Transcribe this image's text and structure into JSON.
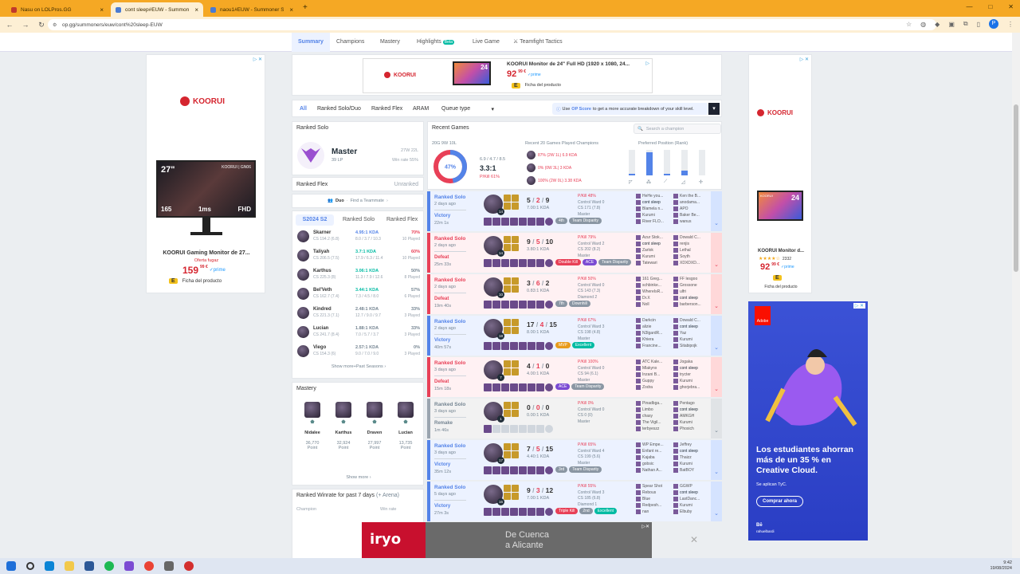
{
  "browser": {
    "tabs": [
      {
        "title": "Nasu on LOLPros.GG"
      },
      {
        "title": "cont sleep#EUW - Summoner S"
      },
      {
        "title": "naou1#EUW - Summoner Stats"
      }
    ],
    "url": "op.gg/summoners/euw/cont%20sleep-EUW"
  },
  "subnav": {
    "items": [
      "Summary",
      "Champions",
      "Mastery",
      "Highlights",
      "Live Game",
      "Teamfight Tactics"
    ],
    "beta": "Beta"
  },
  "ad_top": {
    "title": "KOORUI Monitor de 24\" Full HD (1920 x 1080, 24...",
    "price": "92",
    "cents": "99 €",
    "prime": "✓prime",
    "energy": "E",
    "link": "Ficha del producto",
    "brand": "KOORUI",
    "screen_label": "24"
  },
  "ad_left": {
    "brand": "KOORUI",
    "title": "KOORUI Gaming Monitor de 27...",
    "offer": "Oferta fugaz",
    "price": "159",
    "cents": "99 €",
    "prime": "✓prime",
    "energy": "E",
    "link": "Ficha del producto",
    "screen_size": "27\"",
    "screen_brand": "KOORUI | GN06",
    "screen_fps": "165",
    "screen_ms": "1ms",
    "screen_hd": "FHD"
  },
  "ad_right": {
    "brand": "KOORUI",
    "title": "KOORUI Monitor d...",
    "rating_count": "2332",
    "price": "92",
    "cents": "99 €",
    "prime": "✓prime",
    "energy": "E",
    "link": "Ficha del producto",
    "screen_brand": "KOORUI",
    "screen_label": "24"
  },
  "ad_adobe": {
    "headline": "Los estudiantes ahorran más de un 35 % en Creative Cloud.",
    "terms": "Se aplican TyC.",
    "cta": "Comprar ahora",
    "brand_line1": "Bē",
    "brand_line2": "rahuelbardi",
    "logo": "Adobe"
  },
  "ad_bottom": {
    "brand": "iryo",
    "text1": "De Cuenca",
    "text2": "a Alicante"
  },
  "queue_tabs": {
    "items": [
      "All",
      "Ranked Solo/Duo",
      "Ranked Flex",
      "ARAM"
    ],
    "queue_type": "Queue type",
    "op_score_pre": "Use",
    "op_score_link": "OP Score",
    "op_score_post": "to get a more accurate breakdown of your skill level."
  },
  "ranked_solo": {
    "title": "Ranked Solo",
    "tier": "Master",
    "lp": "39 LP",
    "wl": "27W 22L",
    "wr": "Win rate 55%"
  },
  "ranked_flex": {
    "title": "Ranked Flex",
    "status": "Unranked"
  },
  "duo": {
    "label": "Duo",
    "text": "Find a Teammate"
  },
  "season_tabs": [
    "S2024 S2",
    "Ranked Solo",
    "Ranked Flex"
  ],
  "champ_stats": [
    {
      "name": "Skarner",
      "cs": "CS 194.2 (6.8)",
      "kda": "4.95:1 KDA",
      "kdad": "8.0 / 3.7 / 10.3",
      "wr": "70%",
      "played": "10 Played",
      "kc": "#5383e8",
      "wc": "#e84057"
    },
    {
      "name": "Taliyah",
      "cs": "CS 206.5 (7.5)",
      "kda": "3.7:1 KDA",
      "kdad": "17.9 / 6.3 / 11.4",
      "wr": "60%",
      "played": "10 Played",
      "kc": "#00bba3",
      "wc": "#e84057"
    },
    {
      "name": "Karthus",
      "cs": "CS 225.3 (8)",
      "kda": "3.06:1 KDA",
      "kdad": "11.3 / 7.9 / 12.6",
      "wr": "50%",
      "played": "8 Played",
      "kc": "#00bba3",
      "wc": "#758592"
    },
    {
      "name": "Bel'Veth",
      "cs": "CS 162.7 (7.4)",
      "kda": "3.44:1 KDA",
      "kdad": "7.3 / 4.5 / 8.0",
      "wr": "57%",
      "played": "6 Played",
      "kc": "#00bba3",
      "wc": "#758592"
    },
    {
      "name": "Kindred",
      "cs": "CS 221.3 (7.1)",
      "kda": "2.48:1 KDA",
      "kdad": "12.7 / 9.0 / 9.7",
      "wr": "33%",
      "played": "3 Played",
      "kc": "#758592",
      "wc": "#758592"
    },
    {
      "name": "Lucian",
      "cs": "CS 241.7 (8.4)",
      "kda": "1.88:1 KDA",
      "kdad": "7.0 / 5.7 / 3.7",
      "wr": "33%",
      "played": "3 Played",
      "kc": "#758592",
      "wc": "#758592"
    },
    {
      "name": "Viego",
      "cs": "CS 154.3 (6)",
      "kda": "2.57:1 KDA",
      "kdad": "9.0 / 7.0 / 9.0",
      "wr": "0%",
      "played": "3 Played",
      "kc": "#758592",
      "wc": "#758592"
    }
  ],
  "show_more_seasons": "Show more+Past Seasons",
  "mastery": {
    "title": "Mastery",
    "champs": [
      {
        "name": "Nidalee",
        "points": "36,770",
        "label": "Point"
      },
      {
        "name": "Karthus",
        "points": "32,924",
        "label": "Point"
      },
      {
        "name": "Draven",
        "points": "27,997",
        "label": "Point"
      },
      {
        "name": "Lucian",
        "points": "13,735",
        "label": "Point"
      }
    ],
    "show_more": "Show more"
  },
  "ranked_winrate": {
    "title": "Ranked Winrate for past 7 days",
    "sub": "(+ Arena)",
    "col1": "Champion",
    "col2": "Win rate"
  },
  "recent": {
    "title": "Recent Games",
    "search_placeholder": "Search a champion",
    "record": "20G 9W 10L",
    "pct": "47%",
    "pct_value": 47,
    "kda_line": "6.9 / 4.7 / 8.5",
    "kda": "3.3:1",
    "pkill": "P/Kill 61%",
    "played_title": "Recent 20 Games Played Champions",
    "played": [
      {
        "text": "87% (2W 1L) 6.9 KDA"
      },
      {
        "text": "0% (0W 3L) 3 KDA"
      },
      {
        "text": "100% (2W 0L) 3.38 KDA"
      }
    ],
    "pos_title": "Preferred Position (Rank)",
    "positions": [
      0.05,
      0.9,
      0.05,
      0.2,
      0.0
    ]
  },
  "matches": [
    {
      "type": "Ranked Solo",
      "ago": "2 days ago",
      "res": "Victory",
      "dur": "22m 1s",
      "cls": "win",
      "lvl": "14",
      "k": "5",
      "d": "2",
      "a": "9",
      "kdar": "7.00:1 KDA",
      "badges": [
        {
          "t": "4th",
          "c": ""
        },
        {
          "t": "Team Disparity",
          "c": ""
        }
      ],
      "stats": [
        "P/Kill 48%",
        "Control Ward 0",
        "CS 171 (7.8)",
        "Master"
      ],
      "team1": [
        "HeHe you...",
        "cont sleep",
        "Blamela n...",
        "Kurumi",
        "River FLO..."
      ],
      "team2": [
        "Ken the B...",
        "anodama...",
        "APO",
        "Baker Be...",
        "wanus"
      ]
    },
    {
      "type": "Ranked Solo",
      "ago": "2 days ago",
      "res": "Defeat",
      "dur": "25m 33s",
      "cls": "loss",
      "lvl": "14",
      "k": "9",
      "d": "5",
      "a": "10",
      "kdar": "3.80:1 KDA",
      "badges": [
        {
          "t": "Double Kill",
          "c": "b-red"
        },
        {
          "t": "ACE",
          "c": "b-purple"
        },
        {
          "t": "Team Disparity",
          "c": ""
        }
      ],
      "stats": [
        "P/Kill 79%",
        "Control Ward 2",
        "CS 202 (8.2)",
        "Master"
      ],
      "team1": [
        "Azur Stok...",
        "cont sleep",
        "Zarlok",
        "Kurumi",
        "Tatewari"
      ],
      "team2": [
        "Dowald C...",
        "renjis",
        "Lethal",
        "Soyth",
        "XDXDXD..."
      ]
    },
    {
      "type": "Ranked Solo",
      "ago": "2 days ago",
      "res": "Defeat",
      "dur": "19m 40s",
      "cls": "loss",
      "lvl": "10",
      "k": "3",
      "d": "6",
      "a": "2",
      "kdar": "0.83:1 KDA",
      "badges": [
        {
          "t": "7th",
          "c": ""
        },
        {
          "t": "Downhill",
          "c": ""
        }
      ],
      "stats": [
        "P/Kill 50%",
        "Control Ward 0",
        "CS 143 (7.3)",
        "Diamond 2"
      ],
      "team1": [
        "161 Greg...",
        "schbinke...",
        "WhereIsR...",
        "Dr.X",
        "Noll"
      ],
      "team2": [
        "FF lesgoo",
        "Grossone",
        "ulfri",
        "cont sleep",
        "barberson..."
      ]
    },
    {
      "type": "Ranked Solo",
      "ago": "2 days ago",
      "res": "Victory",
      "dur": "40m 57s",
      "cls": "win",
      "lvl": "18",
      "k": "17",
      "d": "4",
      "a": "15",
      "kdar": "8.00:1 KDA",
      "badges": [
        {
          "t": "MVP",
          "c": "b-orange"
        },
        {
          "t": "Excellent",
          "c": "b-green"
        }
      ],
      "stats": [
        "P/Kill 67%",
        "Control Ward 3",
        "CS 198 (4.8)",
        "Master"
      ],
      "team1": [
        "Darkcin",
        "alizie",
        "N3lgardR...",
        "Khiera",
        "Francine..."
      ],
      "team2": [
        "Dowald C...",
        "cont sleep",
        "Yaz",
        "Kurumi",
        "Sitabipojk"
      ]
    },
    {
      "type": "Ranked Solo",
      "ago": "3 days ago",
      "res": "Defeat",
      "dur": "15m 18s",
      "cls": "loss",
      "lvl": "7",
      "k": "4",
      "d": "1",
      "a": "0",
      "kdar": "4.00:1 KDA",
      "badges": [
        {
          "t": "ACE",
          "c": "b-purple"
        },
        {
          "t": "Team Disparity",
          "c": ""
        }
      ],
      "stats": [
        "P/Kill 100%",
        "Control Ward 0",
        "CS 94 (6.1)",
        "Master"
      ],
      "team1": [
        "ATC Kale...",
        "Mlakynx",
        "Inzani B...",
        "Guppy",
        "Zodra"
      ],
      "team2": [
        "Jogaka",
        "cont sleep",
        "trycter",
        "Kurumi",
        "ghorjebra..."
      ]
    },
    {
      "type": "Ranked Solo",
      "ago": "3 days ago",
      "res": "Remake",
      "dur": "1m 46s",
      "cls": "remake",
      "lvl": "1",
      "k": "0",
      "d": "0",
      "a": "0",
      "kdar": "0.00:1 KDA",
      "badges": [],
      "stats": [
        "P/Kill 0%",
        "Control Ward 0",
        "CS 0 (0)",
        "Master"
      ],
      "team1": [
        "Pinadbga...",
        "Limbo",
        "chasy",
        "The Vigil...",
        "terbyeszz"
      ],
      "team2": [
        "Pentago",
        "cont sleep",
        "AMKGH",
        "Kurumi",
        "Phoxich"
      ]
    },
    {
      "type": "Ranked Solo",
      "ago": "3 days ago",
      "res": "Victory",
      "dur": "35m 12s",
      "cls": "win",
      "lvl": "17",
      "k": "7",
      "d": "5",
      "a": "15",
      "kdar": "4.40:1 KDA",
      "badges": [
        {
          "t": "3rd",
          "c": ""
        },
        {
          "t": "Team Disparity",
          "c": ""
        }
      ],
      "stats": [
        "P/Kill 65%",
        "Control Ward 4",
        "CS 199 (5.6)",
        "Master"
      ],
      "team1": [
        "WP Empe...",
        "Enfant re...",
        "Kajaba",
        "gobsic",
        "Nathan A..."
      ],
      "team2": [
        "Jeffrey",
        "cont sleep",
        "Thaizz",
        "Kurumi",
        "BatBOY"
      ]
    },
    {
      "type": "Ranked Solo",
      "ago": "5 days ago",
      "res": "Victory",
      "dur": "27m 3s",
      "cls": "win",
      "lvl": "16",
      "k": "9",
      "d": "3",
      "a": "12",
      "kdar": "7.00:1 KDA",
      "badges": [
        {
          "t": "Triple Kill",
          "c": "b-red"
        },
        {
          "t": "2nd",
          "c": ""
        },
        {
          "t": "Excellent",
          "c": "b-green"
        }
      ],
      "stats": [
        "P/Kill 55%",
        "Control Ward 3",
        "CS 185 (6.8)",
        "Diamond 1"
      ],
      "team1": [
        "Spear Shot",
        "Rebous",
        "Blue",
        "Redpesh...",
        "nan"
      ],
      "team2": [
        "GGWP",
        "cont sleep",
        "LastDanc...",
        "Kurumi",
        "Elbuby"
      ]
    }
  ],
  "taskbar": {
    "time": "9:42",
    "date": "19/08/2024"
  }
}
